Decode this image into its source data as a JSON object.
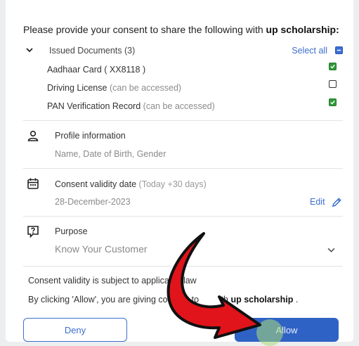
{
  "consent_prompt": {
    "prefix": "Please provide your consent to share the following with ",
    "recipient": "up scholarship",
    "suffix": ":"
  },
  "issued_documents": {
    "label": "Issued Documents (3)",
    "select_all": "Select all",
    "select_all_checked": true,
    "items": [
      {
        "name": "Aadhaar Card ( XX8118 )",
        "note": "",
        "checked": true
      },
      {
        "name": "Driving License",
        "note": "(can be accessed)",
        "checked": false
      },
      {
        "name": "PAN Verification Record",
        "note": "(can be accessed)",
        "checked": true
      }
    ]
  },
  "profile": {
    "title": "Profile information",
    "subtitle": "Name, Date of Birth, Gender",
    "icon": "person-icon"
  },
  "validity": {
    "title": "Consent validity date",
    "title_note": "(Today +30 days)",
    "date": "28-December-2023",
    "edit_label": "Edit",
    "icon": "calendar-icon"
  },
  "purpose": {
    "title": "Purpose",
    "value": "Know Your Customer",
    "icon": "question-icon"
  },
  "notes": {
    "validity_note": "Consent validity is subject to applicable law",
    "allow_prefix": "By clicking 'Allow', you are giving consent to ",
    "allow_gap": "",
    "allow_partial": "th ",
    "allow_recipient": "up scholarship",
    "allow_suffix": " ."
  },
  "buttons": {
    "deny": "Deny",
    "allow": "Allow"
  },
  "colors": {
    "accent": "#3d6fd0",
    "allow_bg": "#2f62c5",
    "check_green": "#2e9a3a",
    "arrow_red": "#e0141a"
  }
}
